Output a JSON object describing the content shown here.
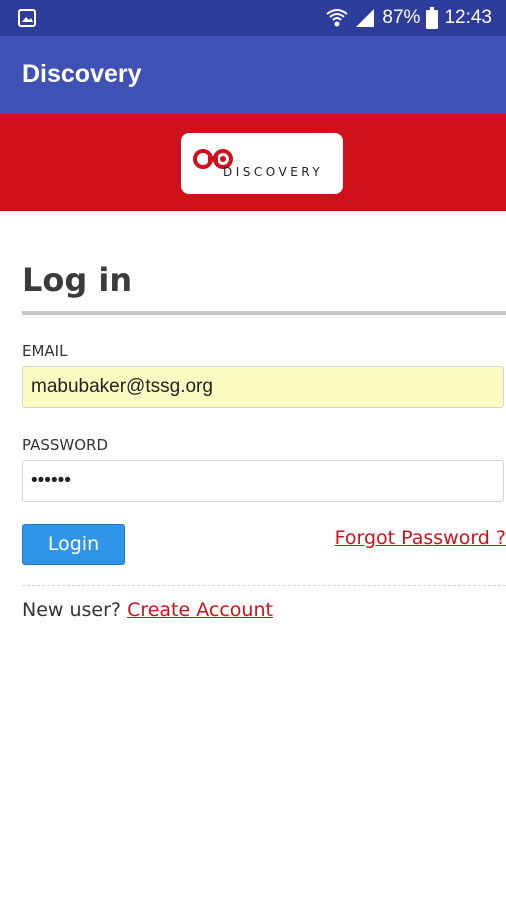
{
  "status_bar": {
    "battery": "87%",
    "time": "12:43"
  },
  "app_bar": {
    "title": "Discovery"
  },
  "brand": {
    "logo_text": "DISCOVERY"
  },
  "login": {
    "heading": "Log in",
    "email_label": "EMAIL",
    "email_value": "mabubaker@tssg.org",
    "password_label": "PASSWORD",
    "password_value": "••••••",
    "login_button": "Login",
    "forgot_link": "Forgot Password ?",
    "new_user_text": "New user?",
    "create_account_link": "Create Account"
  },
  "colors": {
    "status_bar": "#2e3d9c",
    "app_bar": "#3f51b5",
    "banner": "#d0101a",
    "email_field_bg": "#fbfbc2",
    "login_button": "#2f95e8",
    "link": "#d0101a"
  }
}
